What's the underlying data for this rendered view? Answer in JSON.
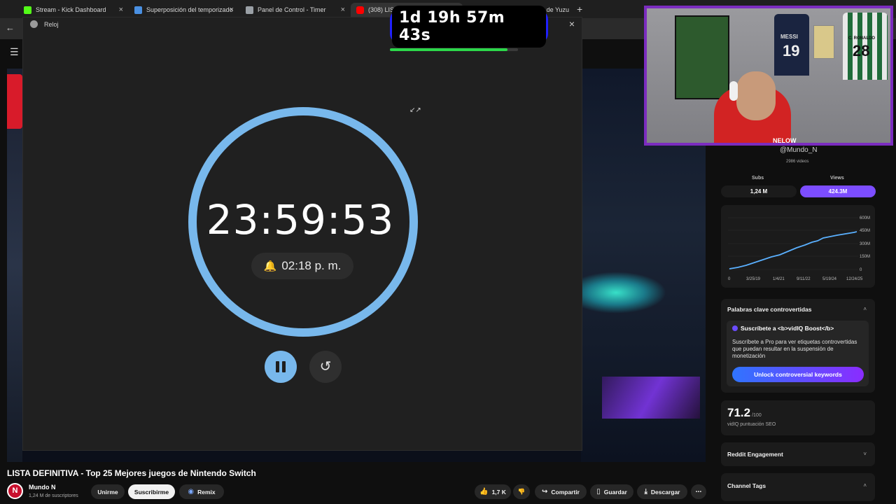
{
  "browser": {
    "tabs": [
      {
        "label": "Stream - Kick Dashboard",
        "color": "#53fc18"
      },
      {
        "label": "Superposición del temporizado",
        "color": "#4a90e2"
      },
      {
        "label": "Panel de Control - Timer",
        "color": "#9aa0a6"
      },
      {
        "label": "(308) LISTA DEFINITIVA - Top 25",
        "color": "#ff0000"
      },
      {
        "label": "Descargar el emulador de Yuzu",
        "color": "#4a90e2"
      }
    ],
    "close_glyph": "×",
    "new_tab_glyph": "+"
  },
  "clock": {
    "title": "Reloj",
    "time": "23:59:53",
    "alarm": "02:18 p. m.",
    "close_glyph": "×",
    "compact_glyph": "↙↗",
    "reset_glyph": "↺",
    "bell_glyph": "🔔",
    "accent": "#78b8ec"
  },
  "countdown": {
    "text": "1d 19h 57m 43s",
    "progress": 0.92
  },
  "webcam": {
    "name": "NELOW",
    "jersey_1_name": "MESSI",
    "jersey_1_number": "19",
    "jersey_2_name": "C. RONALDO",
    "jersey_2_number": "28"
  },
  "vidiq": {
    "handle": "@Mundo_N",
    "videos": "2986 videos",
    "subs_label": "Subs",
    "views_label": "Views",
    "subs_value": "1,24 M",
    "views_value": "424.3M",
    "growth_chart": {
      "y_ticks": [
        "600M",
        "450M",
        "300M",
        "150M",
        "0"
      ],
      "x_ticks": [
        "0",
        "3/25/19",
        "1/4/21",
        "9/11/22",
        "5/19/24",
        "12/24/25"
      ]
    },
    "keywords_title": "Palabras clave controvertidas",
    "upsell_title": "Suscríbete a <b>vidIQ Boost</b>",
    "upsell_text": "Suscríbete a Pro para ver etiquetas controvertidas que puedan resultar en la suspensión de monetización",
    "unlock_label": "Unlock controversial keywords",
    "seo_score": "71.2",
    "seo_max": "/100",
    "seo_label": "vidIQ puntuación SEO",
    "reddit_label": "Reddit Engagement",
    "tags_label": "Channel Tags"
  },
  "video": {
    "title": "LISTA DEFINITIVA - Top 25 Mejores juegos de Nintendo Switch",
    "channel": "Mundo N",
    "subscribers": "1,24 M de suscriptores",
    "avatar_letter": "N",
    "join_label": "Unirme",
    "subscribe_label": "Suscribirme",
    "remix_label": "Remix",
    "likes": "1,7 K",
    "share_label": "Compartir",
    "save_label": "Guardar",
    "download_label": "Descargar"
  }
}
